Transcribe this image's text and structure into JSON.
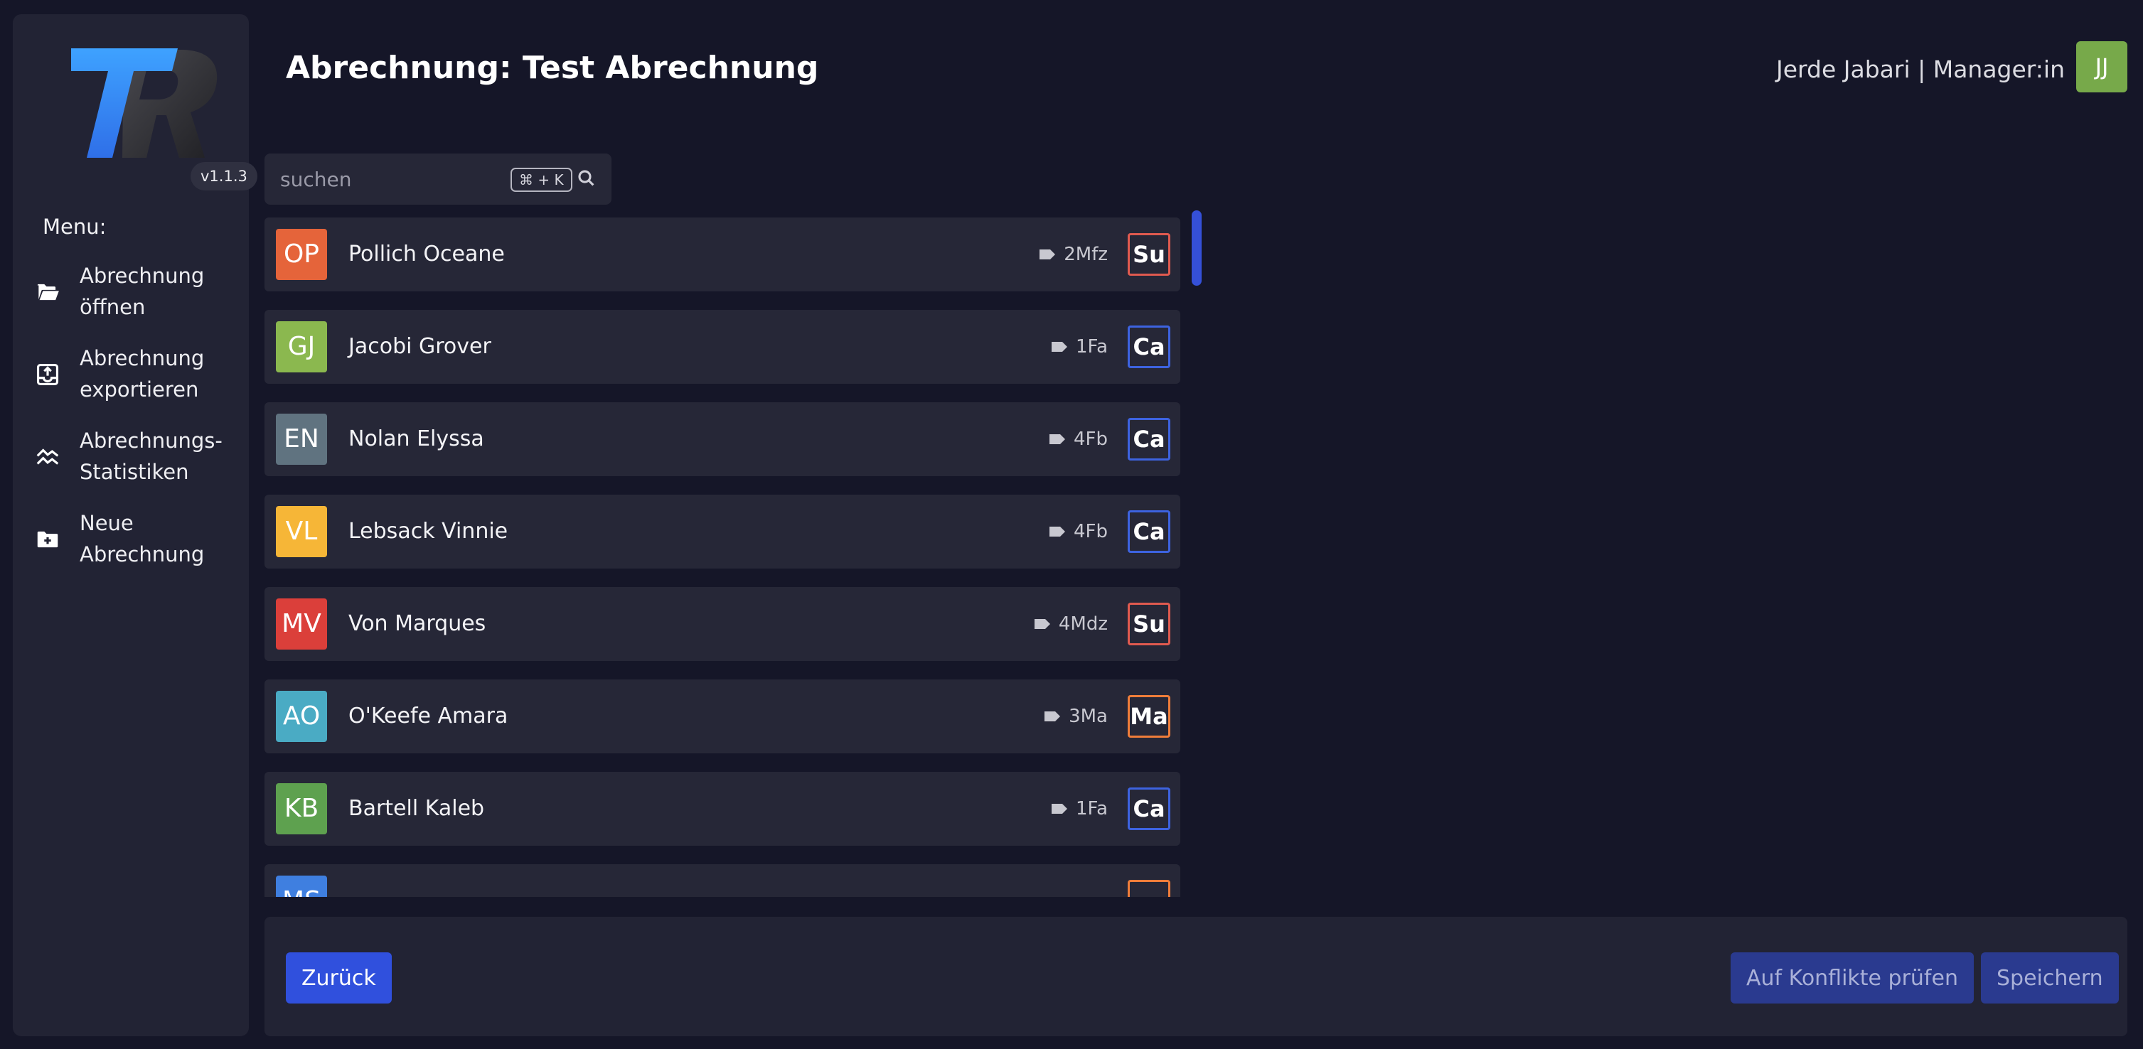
{
  "app": {
    "version": "v1.1.3",
    "menu_title": "Menu:"
  },
  "sidebar": {
    "items": [
      {
        "label_line1": "Abrechnung",
        "label_line2": "öffnen",
        "icon": "folder-open-icon"
      },
      {
        "label_line1": "Abrechnung",
        "label_line2": "exportieren",
        "icon": "export-icon"
      },
      {
        "label_line1": "Abrechnungs-",
        "label_line2": "Statistiken",
        "icon": "statistics-icon"
      },
      {
        "label_line1": "Neue",
        "label_line2": "Abrechnung",
        "icon": "folder-plus-icon"
      }
    ]
  },
  "header": {
    "title": "Abrechnung: Test Abrechnung",
    "user": "Jerde Jabari | Manager:in",
    "avatar_initials": "JJ"
  },
  "search": {
    "placeholder": "suchen",
    "shortcut": "⌘ + K"
  },
  "list": {
    "rows": [
      {
        "initials": "OP",
        "name": "Pollich Oceane",
        "tag": "2Mfz",
        "subject": "Su",
        "avatar_color": "#e5643a",
        "subject_color": "#e05a4f"
      },
      {
        "initials": "GJ",
        "name": "Jacobi Grover",
        "tag": "1Fa",
        "subject": "Ca",
        "avatar_color": "#8bb84f",
        "subject_color": "#3d63e0"
      },
      {
        "initials": "EN",
        "name": "Nolan Elyssa",
        "tag": "4Fb",
        "subject": "Ca",
        "avatar_color": "#607380",
        "subject_color": "#3d63e0"
      },
      {
        "initials": "VL",
        "name": "Lebsack Vinnie",
        "tag": "4Fb",
        "subject": "Ca",
        "avatar_color": "#f6b637",
        "subject_color": "#3d63e0"
      },
      {
        "initials": "MV",
        "name": "Von Marques",
        "tag": "4Mdz",
        "subject": "Su",
        "avatar_color": "#db3f3a",
        "subject_color": "#e05a4f"
      },
      {
        "initials": "AO",
        "name": "O'Keefe Amara",
        "tag": "3Ma",
        "subject": "Ma",
        "avatar_color": "#4aabc4",
        "subject_color": "#ef7d3a"
      },
      {
        "initials": "KB",
        "name": "Bartell Kaleb",
        "tag": "1Fa",
        "subject": "Ca",
        "avatar_color": "#5ea14f",
        "subject_color": "#3d63e0"
      },
      {
        "initials": "MS",
        "name": "",
        "tag": "",
        "subject": "",
        "avatar_color": "#3f7fe0",
        "subject_color": "#ef7d3a"
      }
    ]
  },
  "footer": {
    "back_label": "Zurück",
    "check_label": "Auf Konflikte prüfen",
    "save_label": "Speichern"
  }
}
